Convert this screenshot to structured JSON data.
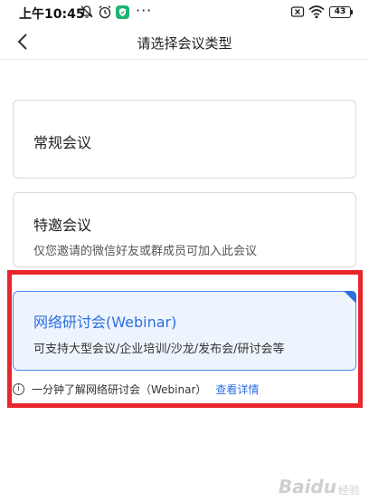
{
  "status_bar": {
    "time": "上午10:45",
    "dots": "···",
    "battery_level": "43",
    "icons": [
      "mute-icon",
      "alarm-icon",
      "shield-app-icon",
      "sim-icon",
      "wifi-icon",
      "battery-icon"
    ]
  },
  "header": {
    "title": "请选择会议类型",
    "back_icon": "chevron-left-icon"
  },
  "meeting_types": [
    {
      "title": "常规会议",
      "description": ""
    },
    {
      "title": "特邀会议",
      "description": "仅您邀请的微信好友或群成员可加入此会议"
    },
    {
      "title": "网络研讨会(Webinar)",
      "description": "可支持大型会议/企业培训/沙龙/发布会/研讨会等",
      "selected": true
    }
  ],
  "info": {
    "text": "一分钟了解网络研讨会（Webinar）",
    "link": "查看详情",
    "icon": "info-icon"
  },
  "watermark": {
    "text": "Baidu",
    "sub": "经验"
  },
  "colors": {
    "accent": "#2a6fe0",
    "highlight": "#e8262b",
    "selected_bg": "#eef4fd",
    "app_icon_green": "#1db470"
  }
}
